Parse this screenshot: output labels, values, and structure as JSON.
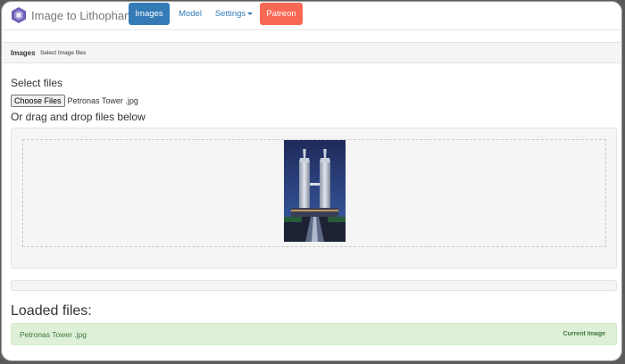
{
  "navbar": {
    "brand": "Image to Lithophane",
    "items": [
      {
        "label": "Images",
        "active": true
      },
      {
        "label": "Model"
      },
      {
        "label": "Settings"
      },
      {
        "label": "Patreon"
      }
    ]
  },
  "breadcrumb": {
    "title": "Images",
    "subtitle": "Select Image files"
  },
  "upload": {
    "heading": "Select files",
    "button_label": "Choose Files",
    "file_name": "Petronas Tower .jpg",
    "drag_heading": "Or drag and drop files below"
  },
  "loaded": {
    "heading": "Loaded files:",
    "files": [
      {
        "name": "Petronas Tower .jpg",
        "badge": "Current Image"
      }
    ]
  },
  "colors": {
    "primary": "#337ab7",
    "patreon": "#f96854",
    "success_bg": "#dff0d8",
    "success_text": "#3c763d"
  }
}
